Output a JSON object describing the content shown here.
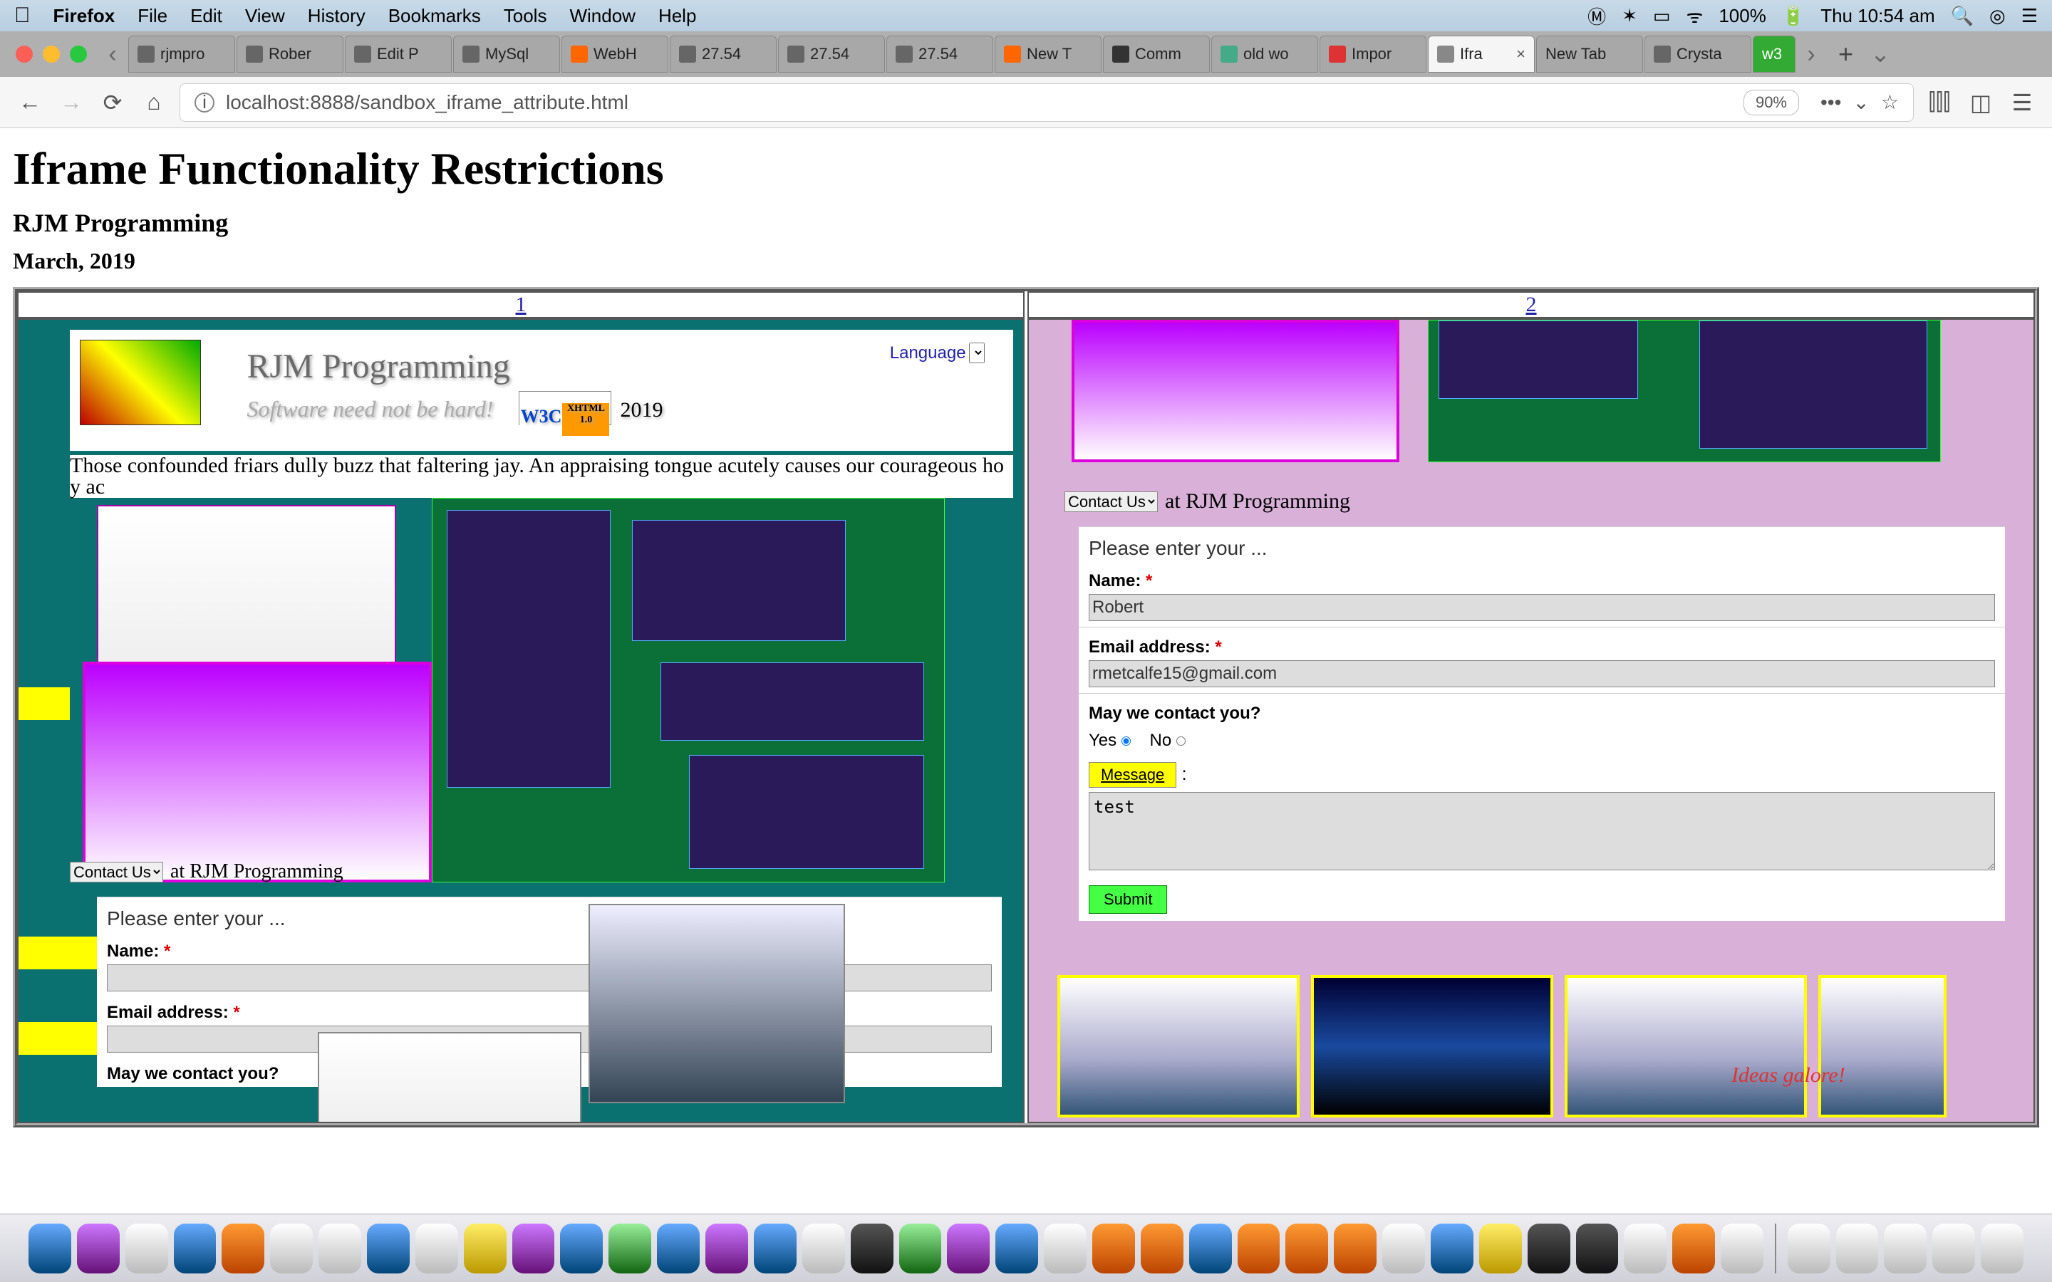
{
  "mac_menu": {
    "app": "Firefox",
    "items": [
      "File",
      "Edit",
      "View",
      "History",
      "Bookmarks",
      "Tools",
      "Window",
      "Help"
    ],
    "battery": "100%",
    "clock": "Thu 10:54 am"
  },
  "tabs": {
    "list": [
      {
        "label": "rjmpro"
      },
      {
        "label": "Rober"
      },
      {
        "label": "Edit P"
      },
      {
        "label": "MySql"
      },
      {
        "label": "WebH"
      },
      {
        "label": "27.54"
      },
      {
        "label": "27.54"
      },
      {
        "label": "27.54"
      },
      {
        "label": "New T"
      },
      {
        "label": "Comm"
      },
      {
        "label": "old wo"
      },
      {
        "label": "Impor"
      },
      {
        "label": "Ifra",
        "active": true
      },
      {
        "label": "New Tab"
      },
      {
        "label": "Crysta"
      }
    ],
    "plus": "+"
  },
  "url": "localhost:8888/sandbox_iframe_attribute.html",
  "zoom": "90%",
  "page": {
    "h1": "Iframe Functionality Restrictions",
    "h2": "RJM Programming",
    "h3": "March, 2019",
    "col1_no": "1",
    "col2_no": "2"
  },
  "rjm": {
    "title": "RJM Programming",
    "sub": "Software need not be hard!",
    "year": "2019",
    "langlabel": "Language",
    "lorem": "Those confounded friars dully buzz that faltering jay. An appraising tongue acutely causes our courageous ho                              y                                                                                                                       ac"
  },
  "contact": {
    "select": "Contact Us",
    "suffix": "at RJM Programming"
  },
  "form": {
    "header": "Please enter your ...",
    "name_lbl": "Name:",
    "name_val": "Robert",
    "email_lbl": "Email address:",
    "email_val": "rmetcalfe15@gmail.com",
    "contact_lbl": "May we contact you?",
    "yes": "Yes",
    "no": "No",
    "msg_btn": "Message",
    "msg_val": "test",
    "submit": "Submit"
  },
  "ideas": "Ideas galore!",
  "w3c": {
    "left": "W3C",
    "right": "XHTML 1.0"
  }
}
